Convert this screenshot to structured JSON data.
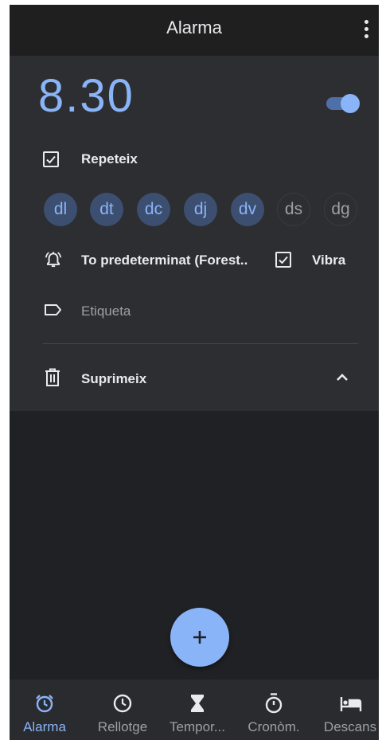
{
  "appbar": {
    "title": "Alarma"
  },
  "alarm": {
    "time": "8.30",
    "enabled": true,
    "repeat_label": "Repeteix",
    "repeat_checked": true,
    "days": [
      {
        "label": "dl",
        "selected": true
      },
      {
        "label": "dt",
        "selected": true
      },
      {
        "label": "dc",
        "selected": true
      },
      {
        "label": "dj",
        "selected": true
      },
      {
        "label": "dv",
        "selected": true
      },
      {
        "label": "ds",
        "selected": false
      },
      {
        "label": "dg",
        "selected": false
      }
    ],
    "sound_label": "To predeterminat (Forest..",
    "vibrate_label": "Vibra",
    "vibrate_checked": true,
    "tag_placeholder": "Etiqueta",
    "delete_label": "Suprimeix"
  },
  "fab": {
    "icon": "plus-icon"
  },
  "bottom_nav": [
    {
      "label": "Alarma",
      "icon": "alarm-icon",
      "active": true
    },
    {
      "label": "Rellotge",
      "icon": "clock-icon",
      "active": false
    },
    {
      "label": "Tempor...",
      "icon": "hourglass-icon",
      "active": false
    },
    {
      "label": "Cronòm.",
      "icon": "stopwatch-icon",
      "active": false
    },
    {
      "label": "Descans",
      "icon": "bed-icon",
      "active": false
    }
  ],
  "colors": {
    "accent": "#8ab4f8",
    "background": "#202124",
    "card": "#2d2e31"
  }
}
